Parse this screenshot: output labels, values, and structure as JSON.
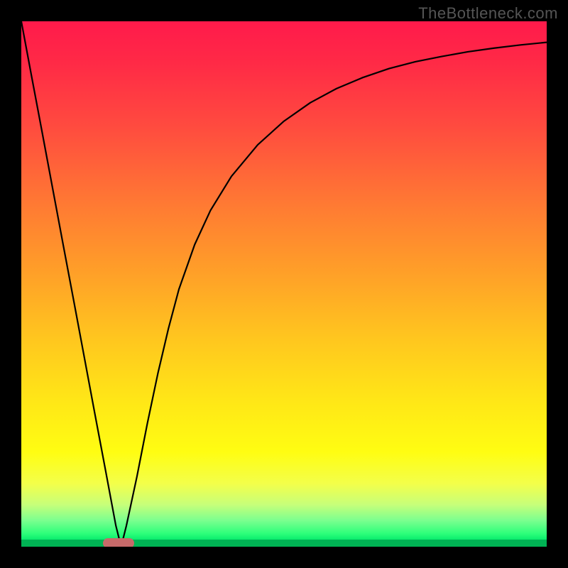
{
  "watermark": "TheBottleneck.com",
  "colors": {
    "frame": "#000000",
    "curve": "#000000",
    "marker": "#c76a6a",
    "gradient_top": "#ff1a4b",
    "gradient_bottom": "#00d060"
  },
  "marker": {
    "x_fraction_start": 0.155,
    "x_fraction_end": 0.215
  },
  "chart_data": {
    "type": "line",
    "title": "",
    "xlabel": "",
    "ylabel": "",
    "xlim": [
      0,
      1
    ],
    "ylim": [
      0,
      1
    ],
    "annotations": [
      "TheBottleneck.com"
    ],
    "grid": false,
    "legend": false,
    "series": [
      {
        "name": "curve",
        "x": [
          0.0,
          0.02,
          0.04,
          0.06,
          0.08,
          0.1,
          0.12,
          0.14,
          0.16,
          0.18,
          0.19,
          0.2,
          0.22,
          0.24,
          0.26,
          0.28,
          0.3,
          0.33,
          0.36,
          0.4,
          0.45,
          0.5,
          0.55,
          0.6,
          0.65,
          0.7,
          0.75,
          0.8,
          0.85,
          0.9,
          0.95,
          1.0
        ],
        "values": [
          1.0,
          0.893,
          0.787,
          0.68,
          0.573,
          0.467,
          0.36,
          0.253,
          0.147,
          0.04,
          0.0,
          0.04,
          0.133,
          0.235,
          0.33,
          0.415,
          0.49,
          0.575,
          0.64,
          0.705,
          0.765,
          0.81,
          0.845,
          0.872,
          0.893,
          0.91,
          0.923,
          0.933,
          0.942,
          0.949,
          0.955,
          0.96
        ]
      }
    ]
  }
}
